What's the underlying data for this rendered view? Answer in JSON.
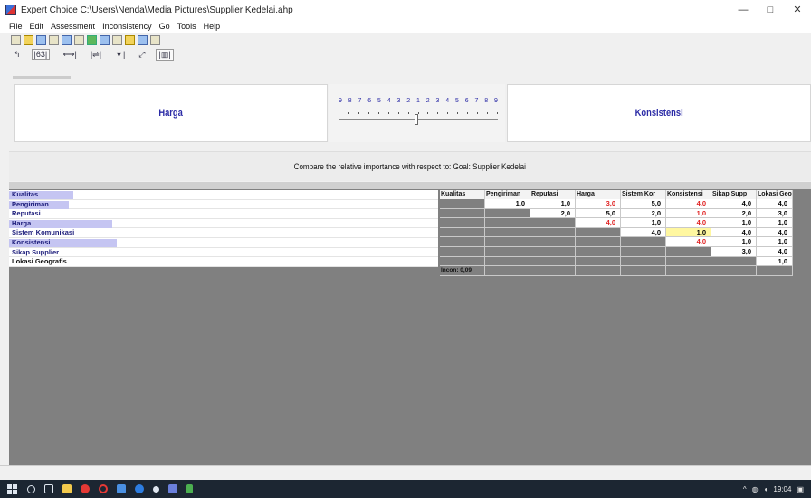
{
  "window": {
    "title": "Expert Choice   C:\\Users\\Nenda\\Media Pictures\\Supplier Kedelai.ahp",
    "controls": [
      "—",
      "□",
      "✕"
    ]
  },
  "menu": [
    "File",
    "Edit",
    "Assessment",
    "Inconsistency",
    "Go",
    "Tools",
    "Help"
  ],
  "toolbar2": [
    "↰",
    "|63|",
    "|⟷|",
    "|⇌|",
    "▼|",
    "⤢",
    "|▥|"
  ],
  "compare": {
    "left": "Harga",
    "right": "Konsistensi",
    "scale": [
      "9",
      "8",
      "7",
      "6",
      "5",
      "4",
      "3",
      "2",
      "1",
      "2",
      "3",
      "4",
      "5",
      "6",
      "7",
      "8",
      "9"
    ]
  },
  "prompt": "Compare the relative importance with respect to: Goal: Supplier Kedelai",
  "matrix": {
    "columns": [
      "Kualitas",
      "Pengiriman",
      "Reputasi",
      "Harga",
      "Sistem Kor",
      "Konsistensi",
      "Sikap Supp",
      "Lokasi Geo"
    ],
    "rows": [
      {
        "label": "Kualitas",
        "bar": 0.15
      },
      {
        "label": "Pengiriman",
        "bar": 0.14
      },
      {
        "label": "Reputasi",
        "bar": 0.0
      },
      {
        "label": "Harga",
        "bar": 0.24
      },
      {
        "label": "Sistem Komunikasi",
        "bar": 0.0
      },
      {
        "label": "Konsistensi",
        "bar": 0.25
      },
      {
        "label": "Sikap Supplier",
        "bar": 0.0
      },
      {
        "label": "Lokasi Geografis",
        "bar": 0.0
      }
    ],
    "cells": [
      [
        null,
        "1,0",
        "1,0",
        "3,0",
        "5,0",
        "4,0",
        "4,0",
        "4,0"
      ],
      [
        null,
        null,
        "2,0",
        "5,0",
        "2,0",
        "1,0",
        "2,0",
        "3,0"
      ],
      [
        null,
        null,
        null,
        "4,0",
        "1,0",
        "4,0",
        "1,0",
        "1,0"
      ],
      [
        null,
        null,
        null,
        null,
        "4,0",
        "1,0",
        "4,0",
        "4,0"
      ],
      [
        null,
        null,
        null,
        null,
        null,
        "4,0",
        "1,0",
        "1,0"
      ],
      [
        null,
        null,
        null,
        null,
        null,
        null,
        "3,0",
        "4,0"
      ],
      [
        null,
        null,
        null,
        null,
        null,
        null,
        null,
        "1,0"
      ],
      [
        null,
        null,
        null,
        null,
        null,
        null,
        null,
        null
      ]
    ],
    "red_cells": [
      "0-3",
      "0-5",
      "1-5",
      "2-3",
      "2-5",
      "4-5"
    ],
    "selected_cell": "3-5",
    "incon_label": "Incon: 0,09",
    "colors": {
      "red": "#e02020",
      "selected": "#fff7a0",
      "label_bar": "#c5c5f2"
    }
  },
  "tray": {
    "caret": "^",
    "time": "19:04"
  }
}
